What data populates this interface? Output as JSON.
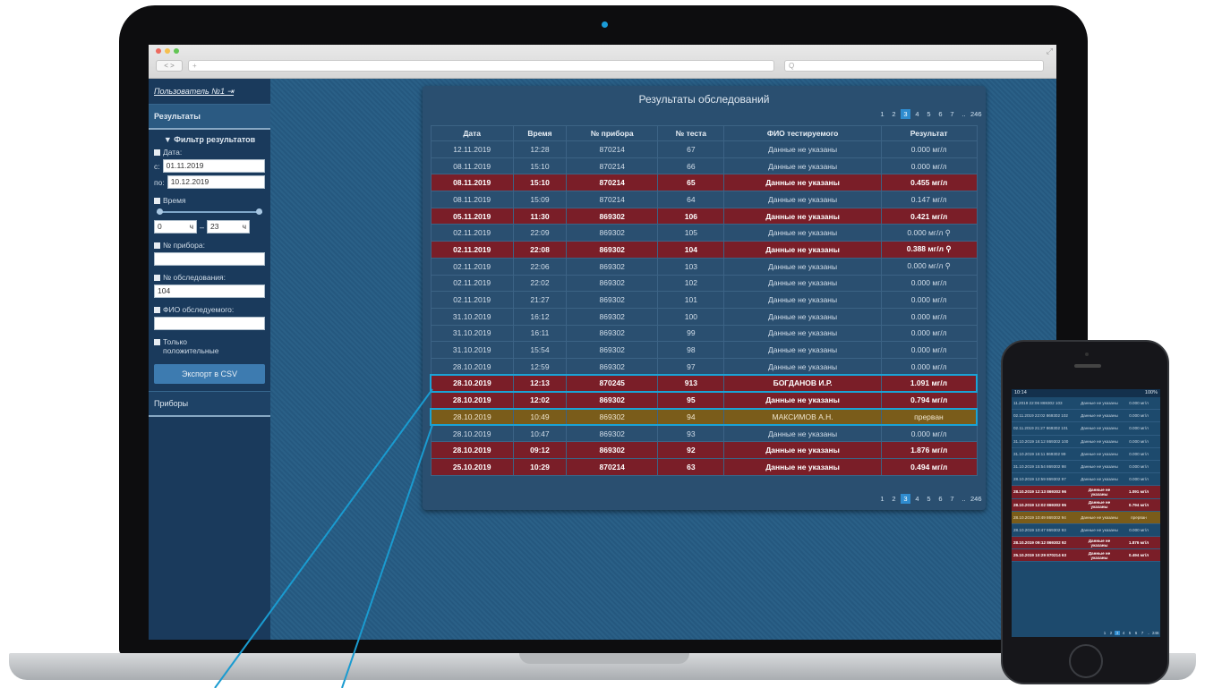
{
  "browser": {
    "nav": "< >",
    "address": "+",
    "search": "Q"
  },
  "sidebar": {
    "user": "Пользователь №1",
    "results_tab": "Результаты",
    "filter_title": "Фильтр результатов",
    "date_label": "Дата:",
    "from_prefix": "с:",
    "from_value": "01.11.2019",
    "to_prefix": "по:",
    "to_value": "10.12.2019",
    "time_label": "Время",
    "time_from": "0",
    "time_to": "23",
    "hour_unit": "ч",
    "dash": "–",
    "device_label": "№ прибора:",
    "device_value": "",
    "exam_label": "№ обследования:",
    "exam_value": "104",
    "name_label": "ФИО обследуемого:",
    "name_value": "",
    "positive_label": "Только положительные",
    "export_button": "Экспорт в CSV",
    "devices_tab": "Приборы"
  },
  "panel": {
    "title": "Результаты обследований",
    "pages": [
      "1",
      "2",
      "3",
      "4",
      "5",
      "6",
      "7",
      "..",
      "246"
    ],
    "active_page": "3",
    "columns": [
      "Дата",
      "Время",
      "№ прибора",
      "№ теста",
      "ФИО тестируемого",
      "Результат"
    ],
    "rows": [
      {
        "d": "12.11.2019",
        "t": "12:28",
        "dev": "870214",
        "test": "67",
        "name": "Данные не указаны",
        "res": "0.000 мг/л",
        "s": ""
      },
      {
        "d": "08.11.2019",
        "t": "15:10",
        "dev": "870214",
        "test": "66",
        "name": "Данные не указаны",
        "res": "0.000 мг/л",
        "s": ""
      },
      {
        "d": "08.11.2019",
        "t": "15:10",
        "dev": "870214",
        "test": "65",
        "name": "Данные не указаны",
        "res": "0.455 мг/л",
        "s": "hl"
      },
      {
        "d": "08.11.2019",
        "t": "15:09",
        "dev": "870214",
        "test": "64",
        "name": "Данные не указаны",
        "res": "0.147 мг/л",
        "s": ""
      },
      {
        "d": "05.11.2019",
        "t": "11:30",
        "dev": "869302",
        "test": "106",
        "name": "Данные не указаны",
        "res": "0.421 мг/л",
        "s": "hl"
      },
      {
        "d": "02.11.2019",
        "t": "22:09",
        "dev": "869302",
        "test": "105",
        "name": "Данные не указаны",
        "res": "0.000 мг/л ⚲",
        "s": ""
      },
      {
        "d": "02.11.2019",
        "t": "22:08",
        "dev": "869302",
        "test": "104",
        "name": "Данные не указаны",
        "res": "0.388 мг/л ⚲",
        "s": "hl"
      },
      {
        "d": "02.11.2019",
        "t": "22:06",
        "dev": "869302",
        "test": "103",
        "name": "Данные не указаны",
        "res": "0.000 мг/л ⚲",
        "s": ""
      },
      {
        "d": "02.11.2019",
        "t": "22:02",
        "dev": "869302",
        "test": "102",
        "name": "Данные не указаны",
        "res": "0.000 мг/л",
        "s": ""
      },
      {
        "d": "02.11.2019",
        "t": "21:27",
        "dev": "869302",
        "test": "101",
        "name": "Данные не указаны",
        "res": "0.000 мг/л",
        "s": ""
      },
      {
        "d": "31.10.2019",
        "t": "16:12",
        "dev": "869302",
        "test": "100",
        "name": "Данные не указаны",
        "res": "0.000 мг/л",
        "s": ""
      },
      {
        "d": "31.10.2019",
        "t": "16:11",
        "dev": "869302",
        "test": "99",
        "name": "Данные не указаны",
        "res": "0.000 мг/л",
        "s": ""
      },
      {
        "d": "31.10.2019",
        "t": "15:54",
        "dev": "869302",
        "test": "98",
        "name": "Данные не указаны",
        "res": "0.000 мг/л",
        "s": ""
      },
      {
        "d": "28.10.2019",
        "t": "12:59",
        "dev": "869302",
        "test": "97",
        "name": "Данные не указаны",
        "res": "0.000 мг/л",
        "s": ""
      },
      {
        "d": "28.10.2019",
        "t": "12:13",
        "dev": "870245",
        "test": "913",
        "name": "БОГДАНОВ И.Р.",
        "res": "1.091 мг/л",
        "s": "hl sel"
      },
      {
        "d": "28.10.2019",
        "t": "12:02",
        "dev": "869302",
        "test": "95",
        "name": "Данные не указаны",
        "res": "0.794 мг/л",
        "s": "hl"
      },
      {
        "d": "28.10.2019",
        "t": "10:49",
        "dev": "869302",
        "test": "94",
        "name": "МАКСИМОВ А.Н.",
        "res": "прерван",
        "s": "ab sel"
      },
      {
        "d": "28.10.2019",
        "t": "10:47",
        "dev": "869302",
        "test": "93",
        "name": "Данные не указаны",
        "res": "0.000 мг/л",
        "s": ""
      },
      {
        "d": "28.10.2019",
        "t": "09:12",
        "dev": "869302",
        "test": "92",
        "name": "Данные не указаны",
        "res": "1.876 мг/л",
        "s": "hl"
      },
      {
        "d": "25.10.2019",
        "t": "10:29",
        "dev": "870214",
        "test": "63",
        "name": "Данные не указаны",
        "res": "0.494 мг/л",
        "s": "hl"
      }
    ]
  },
  "phone": {
    "status_left": "10:14",
    "status_right": "100%",
    "rows": [
      {
        "a": "11.2019 22:06 869302 103",
        "b": "Данные не указаны",
        "c": "0.000 мг/л",
        "s": ""
      },
      {
        "a": "02.11.2019 22:02 869302 102",
        "b": "Данные не указаны",
        "c": "0.000 мг/л",
        "s": ""
      },
      {
        "a": "02.11.2019 21:27 869302 101",
        "b": "Данные не указаны",
        "c": "0.000 мг/л",
        "s": ""
      },
      {
        "a": "31.10.2019 16:12 869302 100",
        "b": "Данные не указаны",
        "c": "0.000 мг/л",
        "s": ""
      },
      {
        "a": "31.10.2019 16:11 869302 99",
        "b": "Данные не указаны",
        "c": "0.000 мг/л",
        "s": ""
      },
      {
        "a": "31.10.2019 15:54 869302 98",
        "b": "Данные не указаны",
        "c": "0.000 мг/л",
        "s": ""
      },
      {
        "a": "28.10.2019 12:59 869302 97",
        "b": "Данные не указаны",
        "c": "0.000 мг/л",
        "s": ""
      },
      {
        "a": "28.10.2019 12:13 869302 96",
        "b": "Данные не указаны",
        "c": "1.091 мг/л",
        "s": "hl"
      },
      {
        "a": "28.10.2019 12:02 869302 95",
        "b": "Данные не указаны",
        "c": "0.794 мг/л",
        "s": "hl"
      },
      {
        "a": "28.10.2019 10:49 869302 94",
        "b": "Данные не указаны",
        "c": "прерван",
        "s": "ab"
      },
      {
        "a": "28.10.2019 10:47 869302 93",
        "b": "Данные не указаны",
        "c": "0.000 мг/л",
        "s": ""
      },
      {
        "a": "28.10.2019 09:12 869302 92",
        "b": "Данные не указаны",
        "c": "1.876 мг/л",
        "s": "hl"
      },
      {
        "a": "25.10.2019 10:29 870214 63",
        "b": "Данные не указаны",
        "c": "0.494 мг/л",
        "s": "hl"
      }
    ],
    "pages": [
      "1",
      "2",
      "3",
      "4",
      "5",
      "6",
      "7",
      "..",
      "246"
    ]
  },
  "colors": {
    "highlight": "#7a1e28",
    "aborted": "#7a5c1a",
    "accent": "#1aa3d6",
    "sidebar": "#1a3a5c"
  }
}
